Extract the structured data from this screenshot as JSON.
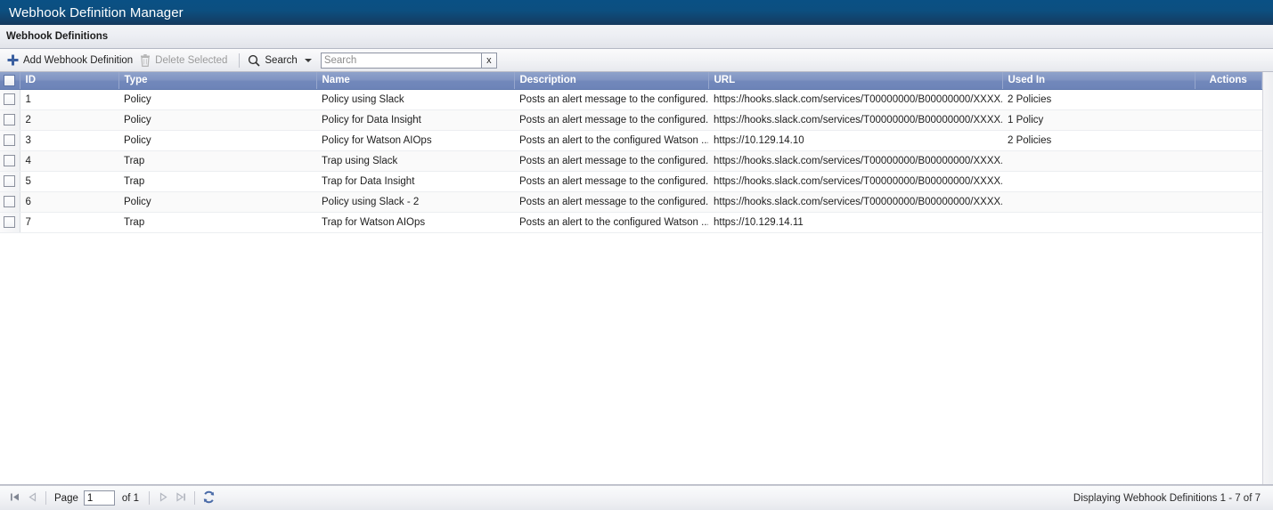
{
  "window": {
    "title": "Webhook Definition Manager"
  },
  "panel": {
    "header": "Webhook Definitions"
  },
  "toolbar": {
    "add_label": "Add Webhook Definition",
    "delete_label": "Delete Selected",
    "search_label": "Search",
    "search_value": "",
    "search_placeholder": "Search",
    "clear_label": "x",
    "icons": {
      "add": "plus-icon",
      "delete": "trash-icon",
      "search": "magnifier-icon",
      "dropdown": "caret-down-icon"
    }
  },
  "grid": {
    "columns": [
      {
        "key": "select",
        "label": ""
      },
      {
        "key": "id",
        "label": "ID"
      },
      {
        "key": "type",
        "label": "Type"
      },
      {
        "key": "name",
        "label": "Name"
      },
      {
        "key": "description",
        "label": "Description"
      },
      {
        "key": "url",
        "label": "URL"
      },
      {
        "key": "used_in",
        "label": "Used In"
      },
      {
        "key": "actions",
        "label": "Actions"
      }
    ],
    "rows": [
      {
        "id": "1",
        "type": "Policy",
        "name": "Policy using Slack",
        "description": "Posts an alert message to the configured...",
        "url": "https://hooks.slack.com/services/T00000000/B00000000/XXXX...",
        "used_in": "2 Policies",
        "actions": ""
      },
      {
        "id": "2",
        "type": "Policy",
        "name": "Policy for Data Insight",
        "description": "Posts an alert message to the configured...",
        "url": "https://hooks.slack.com/services/T00000000/B00000000/XXXX...",
        "used_in": "1 Policy",
        "actions": ""
      },
      {
        "id": "3",
        "type": "Policy",
        "name": "Policy for Watson AIOps",
        "description": "Posts an alert to the configured Watson ...",
        "url": "https://10.129.14.10",
        "used_in": "2 Policies",
        "actions": ""
      },
      {
        "id": "4",
        "type": "Trap",
        "name": "Trap using Slack",
        "description": "Posts an alert message to the configured...",
        "url": "https://hooks.slack.com/services/T00000000/B00000000/XXXX...",
        "used_in": "",
        "actions": ""
      },
      {
        "id": "5",
        "type": "Trap",
        "name": "Trap for Data Insight",
        "description": "Posts an alert message to the configured...",
        "url": "https://hooks.slack.com/services/T00000000/B00000000/XXXX...",
        "used_in": "",
        "actions": ""
      },
      {
        "id": "6",
        "type": "Policy",
        "name": "Policy using Slack - 2",
        "description": "Posts an alert message to the configured...",
        "url": "https://hooks.slack.com/services/T00000000/B00000000/XXXX...",
        "used_in": "",
        "actions": ""
      },
      {
        "id": "7",
        "type": "Trap",
        "name": "Trap for Watson AIOps",
        "description": "Posts an alert to the configured Watson ...",
        "url": "https://10.129.14.11",
        "used_in": "",
        "actions": ""
      }
    ]
  },
  "footer": {
    "page_label": "Page",
    "page_value": "1",
    "of_label": "of 1",
    "status": "Displaying Webhook Definitions 1 - 7 of 7",
    "icons": {
      "first": "first-page-icon",
      "prev": "previous-page-icon",
      "next": "next-page-icon",
      "last": "last-page-icon",
      "refresh": "refresh-icon"
    }
  },
  "colors": {
    "titlebar_top": "#0a5084",
    "titlebar_bottom": "#153a5e",
    "header_row": "#7288bb",
    "accent_blue": "#3b5998",
    "row_alt": "#fafafa"
  }
}
